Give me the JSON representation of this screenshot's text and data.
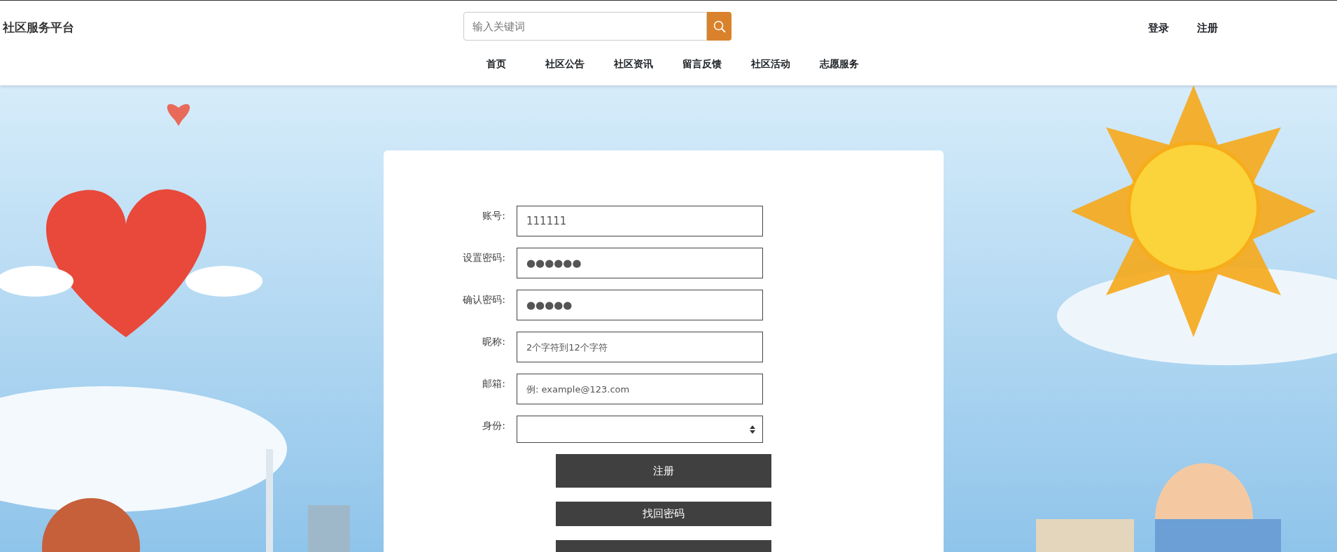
{
  "header": {
    "site_title": "社区服务平台",
    "search": {
      "placeholder": "输入关键词"
    },
    "auth_links": [
      "登录",
      "注册"
    ],
    "nav": [
      {
        "label": "首页"
      },
      {
        "label": "社区公告"
      },
      {
        "label": "社区资讯"
      },
      {
        "label": "留言反馈"
      },
      {
        "label": "社区活动"
      },
      {
        "label": "志愿服务"
      }
    ]
  },
  "form": {
    "fields": [
      {
        "label": "账号:",
        "kind": "text",
        "value": "111111"
      },
      {
        "label": "设置密码:",
        "kind": "text",
        "value": "●●●●●●"
      },
      {
        "label": "确认密码:",
        "kind": "text",
        "value": "●●●●●"
      },
      {
        "label": "昵称:",
        "kind": "text",
        "placeholder": "2个字符到12个字符"
      },
      {
        "label": "邮箱:",
        "kind": "text",
        "placeholder": "例: example@123.com"
      },
      {
        "label": "身份:",
        "kind": "select"
      }
    ],
    "buttons": [
      {
        "label": "注册",
        "kind": "tall"
      },
      {
        "label": "找回密码",
        "kind": "short"
      },
      {
        "kind": "cut"
      }
    ]
  }
}
